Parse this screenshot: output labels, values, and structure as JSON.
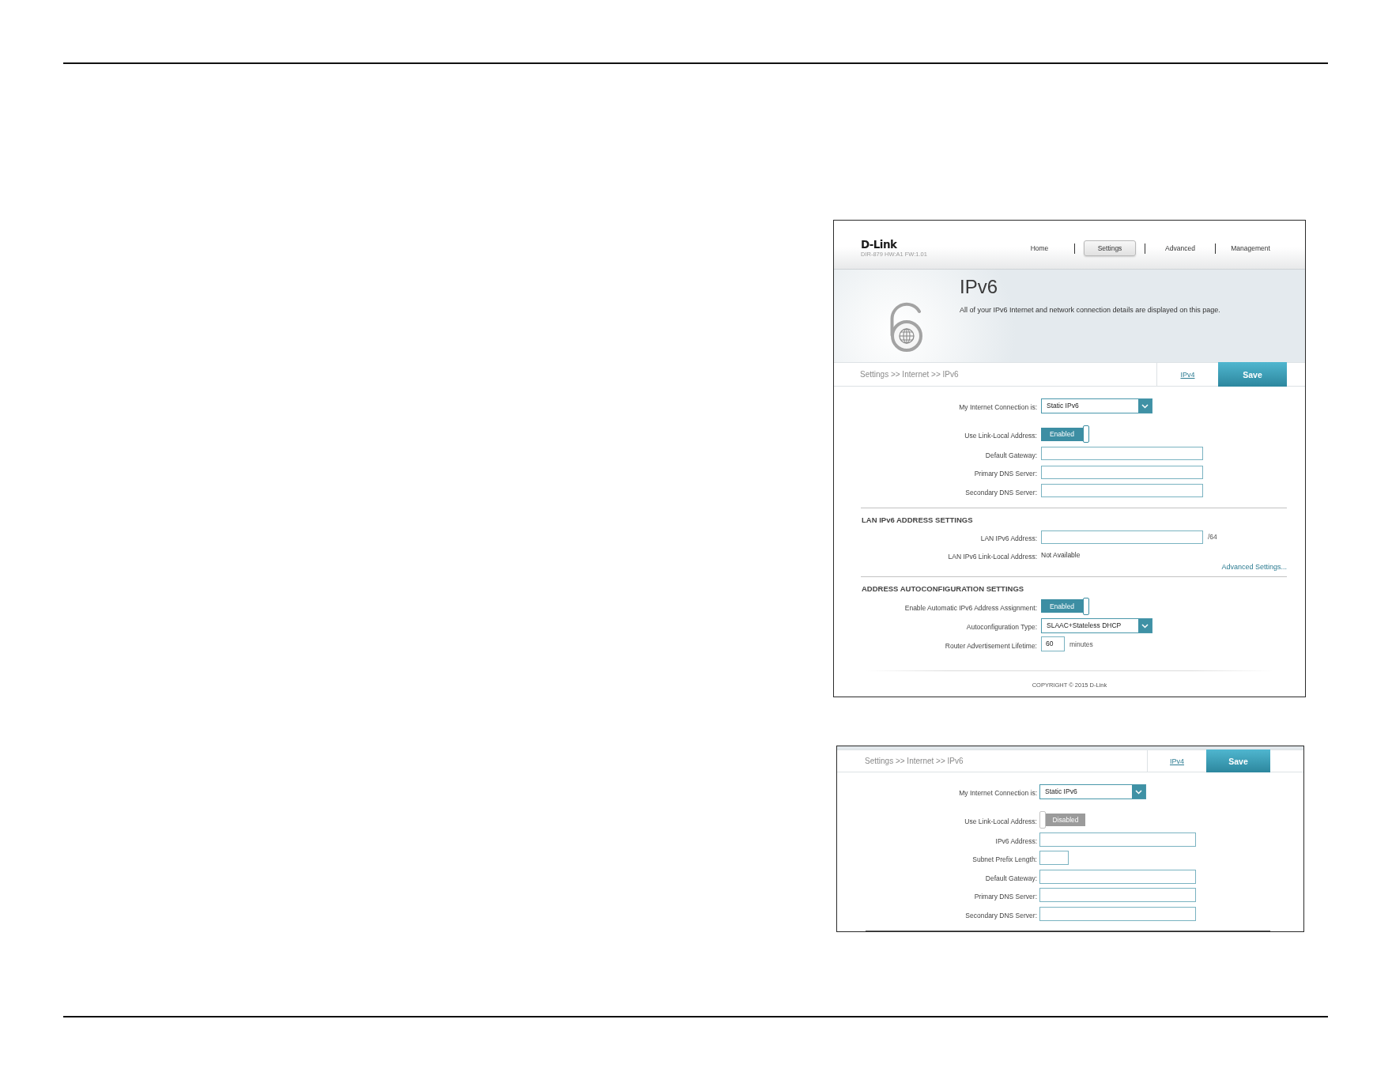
{
  "screenshots": [
    {
      "header": {
        "logo": "D-Link",
        "model": "DIR-879 HW:A1 FW:1.01",
        "nav": [
          {
            "label": "Home",
            "selected": false
          },
          {
            "label": "Settings",
            "selected": true
          },
          {
            "label": "Advanced",
            "selected": false
          },
          {
            "label": "Management",
            "selected": false
          }
        ]
      },
      "banner": {
        "title": "IPv6",
        "description": "All of your IPv6 Internet and network connection details are displayed on this page."
      },
      "breadcrumb": "Settings >> Internet >> IPv6",
      "tab_link": "IPv4",
      "save_button": "Save",
      "sections": [
        {
          "rows": [
            {
              "kind": "select",
              "label": "My Internet Connection is:",
              "value": "Static IPv6"
            },
            {
              "kind": "toggle",
              "label": "Use Link-Local Address:",
              "on": true,
              "value": "Enabled"
            },
            {
              "kind": "input",
              "label": "Default Gateway:"
            },
            {
              "kind": "input",
              "label": "Primary DNS Server:"
            },
            {
              "kind": "input",
              "label": "Secondary DNS Server:"
            }
          ]
        },
        {
          "heading": "LAN IPv6 ADDRESS SETTINGS",
          "rows": [
            {
              "kind": "input",
              "label": "LAN IPv6 Address:",
              "suffix": "/64"
            },
            {
              "kind": "text",
              "label": "LAN IPv6 Link-Local Address:",
              "value": "Not Available"
            },
            {
              "kind": "link",
              "label": "Advanced Settings..."
            }
          ]
        },
        {
          "heading": "ADDRESS AUTOCONFIGURATION SETTINGS",
          "rows": [
            {
              "kind": "toggle",
              "label": "Enable Automatic IPv6 Address Assignment:",
              "on": true,
              "value": "Enabled"
            },
            {
              "kind": "select",
              "label": "Autoconfiguration Type:",
              "value": "SLAAC+Stateless DHCP"
            },
            {
              "kind": "short_input",
              "label": "Router Advertisement Lifetime:",
              "value": "60",
              "suffix": "minutes"
            }
          ]
        }
      ],
      "footer": "COPYRIGHT © 2015 D-Link"
    },
    {
      "breadcrumb": "Settings >> Internet >> IPv6",
      "tab_link": "IPv4",
      "save_button": "Save",
      "sections": [
        {
          "rows": [
            {
              "kind": "select",
              "label": "My Internet Connection is:",
              "value": "Static IPv6"
            },
            {
              "kind": "toggle",
              "label": "Use Link-Local Address:",
              "on": false,
              "value": "Disabled"
            },
            {
              "kind": "input",
              "label": "IPv6 Address:"
            },
            {
              "kind": "short_input",
              "label": "Subnet Prefix Length:"
            },
            {
              "kind": "input",
              "label": "Default Gateway:"
            },
            {
              "kind": "input",
              "label": "Primary DNS Server:"
            },
            {
              "kind": "input",
              "label": "Secondary DNS Server:"
            }
          ]
        }
      ]
    }
  ]
}
